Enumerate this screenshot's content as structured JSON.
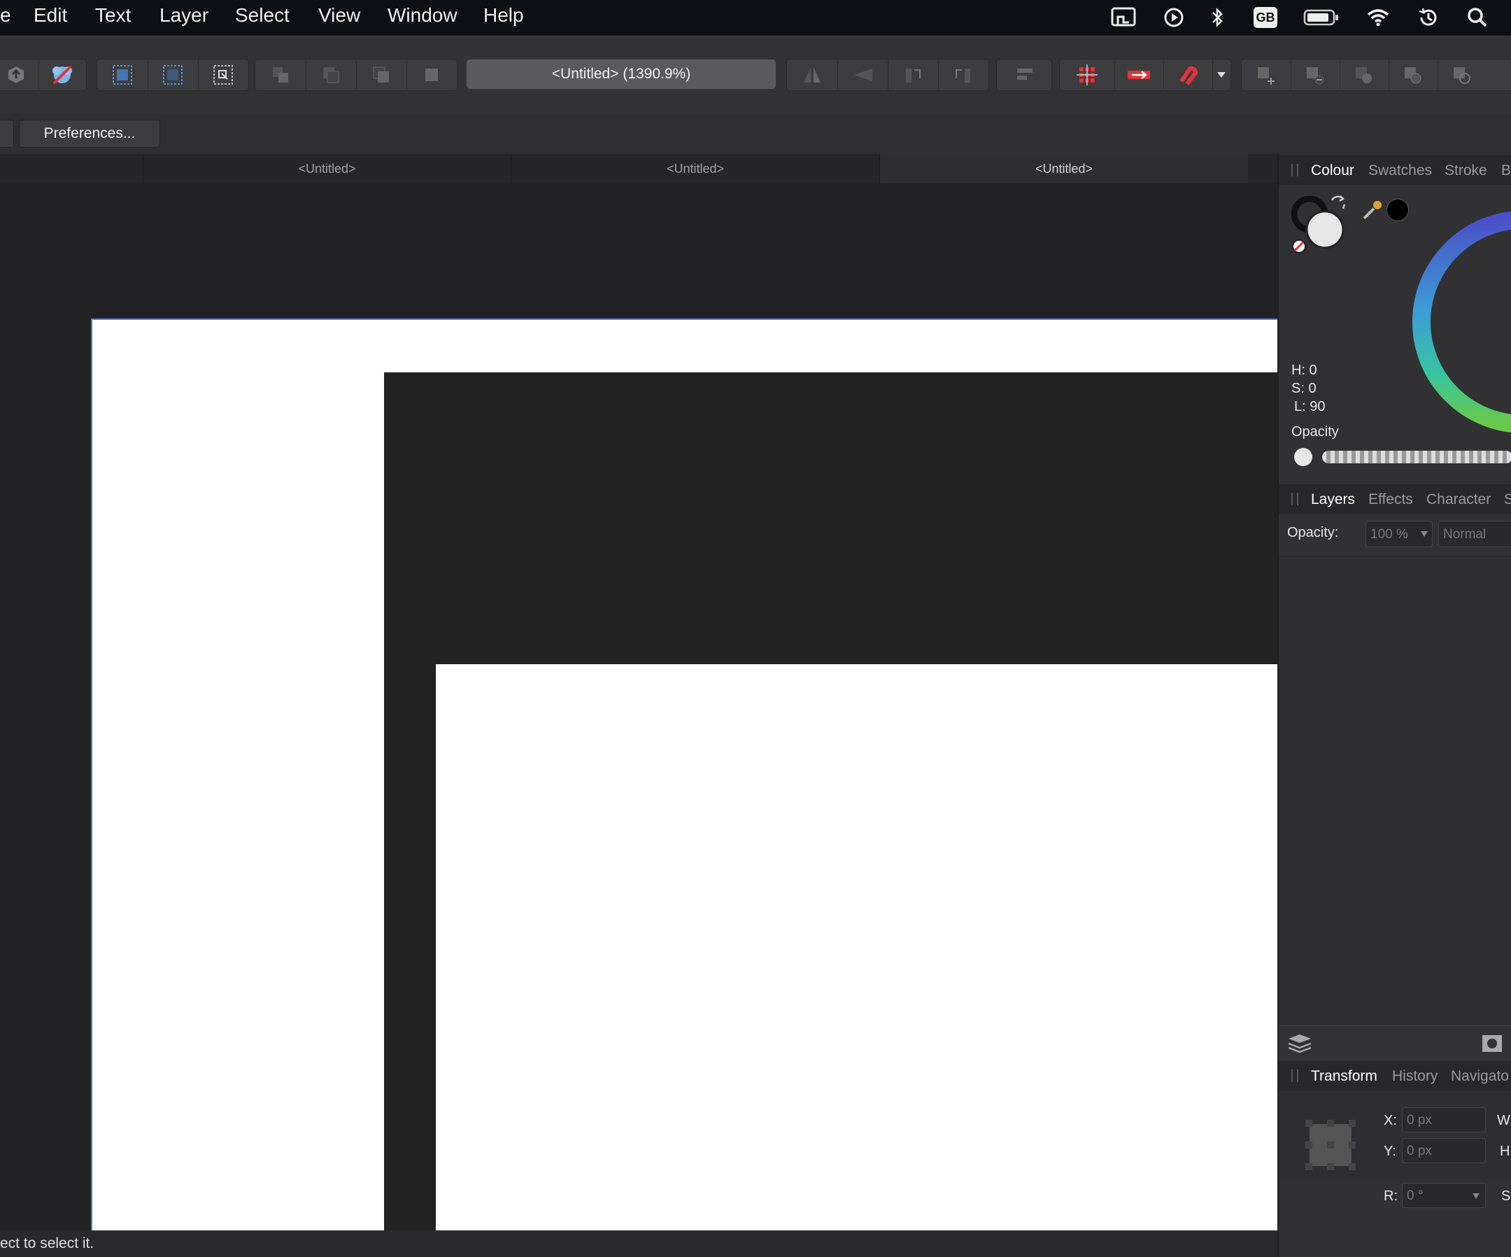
{
  "menu": {
    "items": [
      "e",
      "Edit",
      "Text",
      "Layer",
      "Select",
      "View",
      "Window",
      "Help"
    ]
  },
  "system_tray": {
    "keyboard_label": "GB"
  },
  "toolbar": {
    "document_title": "<Untitled> (1390.9%)"
  },
  "context_toolbar": {
    "preferences_label": "Preferences..."
  },
  "doc_tabs": [
    "<Untitled>",
    "<Untitled>",
    "<Untitled>"
  ],
  "colour_panel": {
    "tabs": [
      "Colour",
      "Swatches",
      "Stroke",
      "Br"
    ],
    "hue": "H: 0",
    "saturation": "S: 0",
    "lightness": "L: 90",
    "opacity_label": "Opacity"
  },
  "layers_panel": {
    "tabs": [
      "Layers",
      "Effects",
      "Character",
      "S"
    ],
    "opacity_label": "Opacity:",
    "opacity_value": "100 %",
    "blend_mode": "Normal"
  },
  "transform_panel": {
    "tabs": [
      "Transform",
      "History",
      "Navigato"
    ],
    "x_label": "X:",
    "x_value": "0 px",
    "y_label": "Y:",
    "y_value": "0 px",
    "r_label": "R:",
    "r_value": "0 °",
    "w_label": "W",
    "h_label": "H",
    "s_label": "S"
  },
  "status_bar": {
    "text": "ect to select it."
  },
  "colors": {
    "accent_red": "#e0333a",
    "canvas_dark": "#222224",
    "panel_bg": "#313133"
  }
}
